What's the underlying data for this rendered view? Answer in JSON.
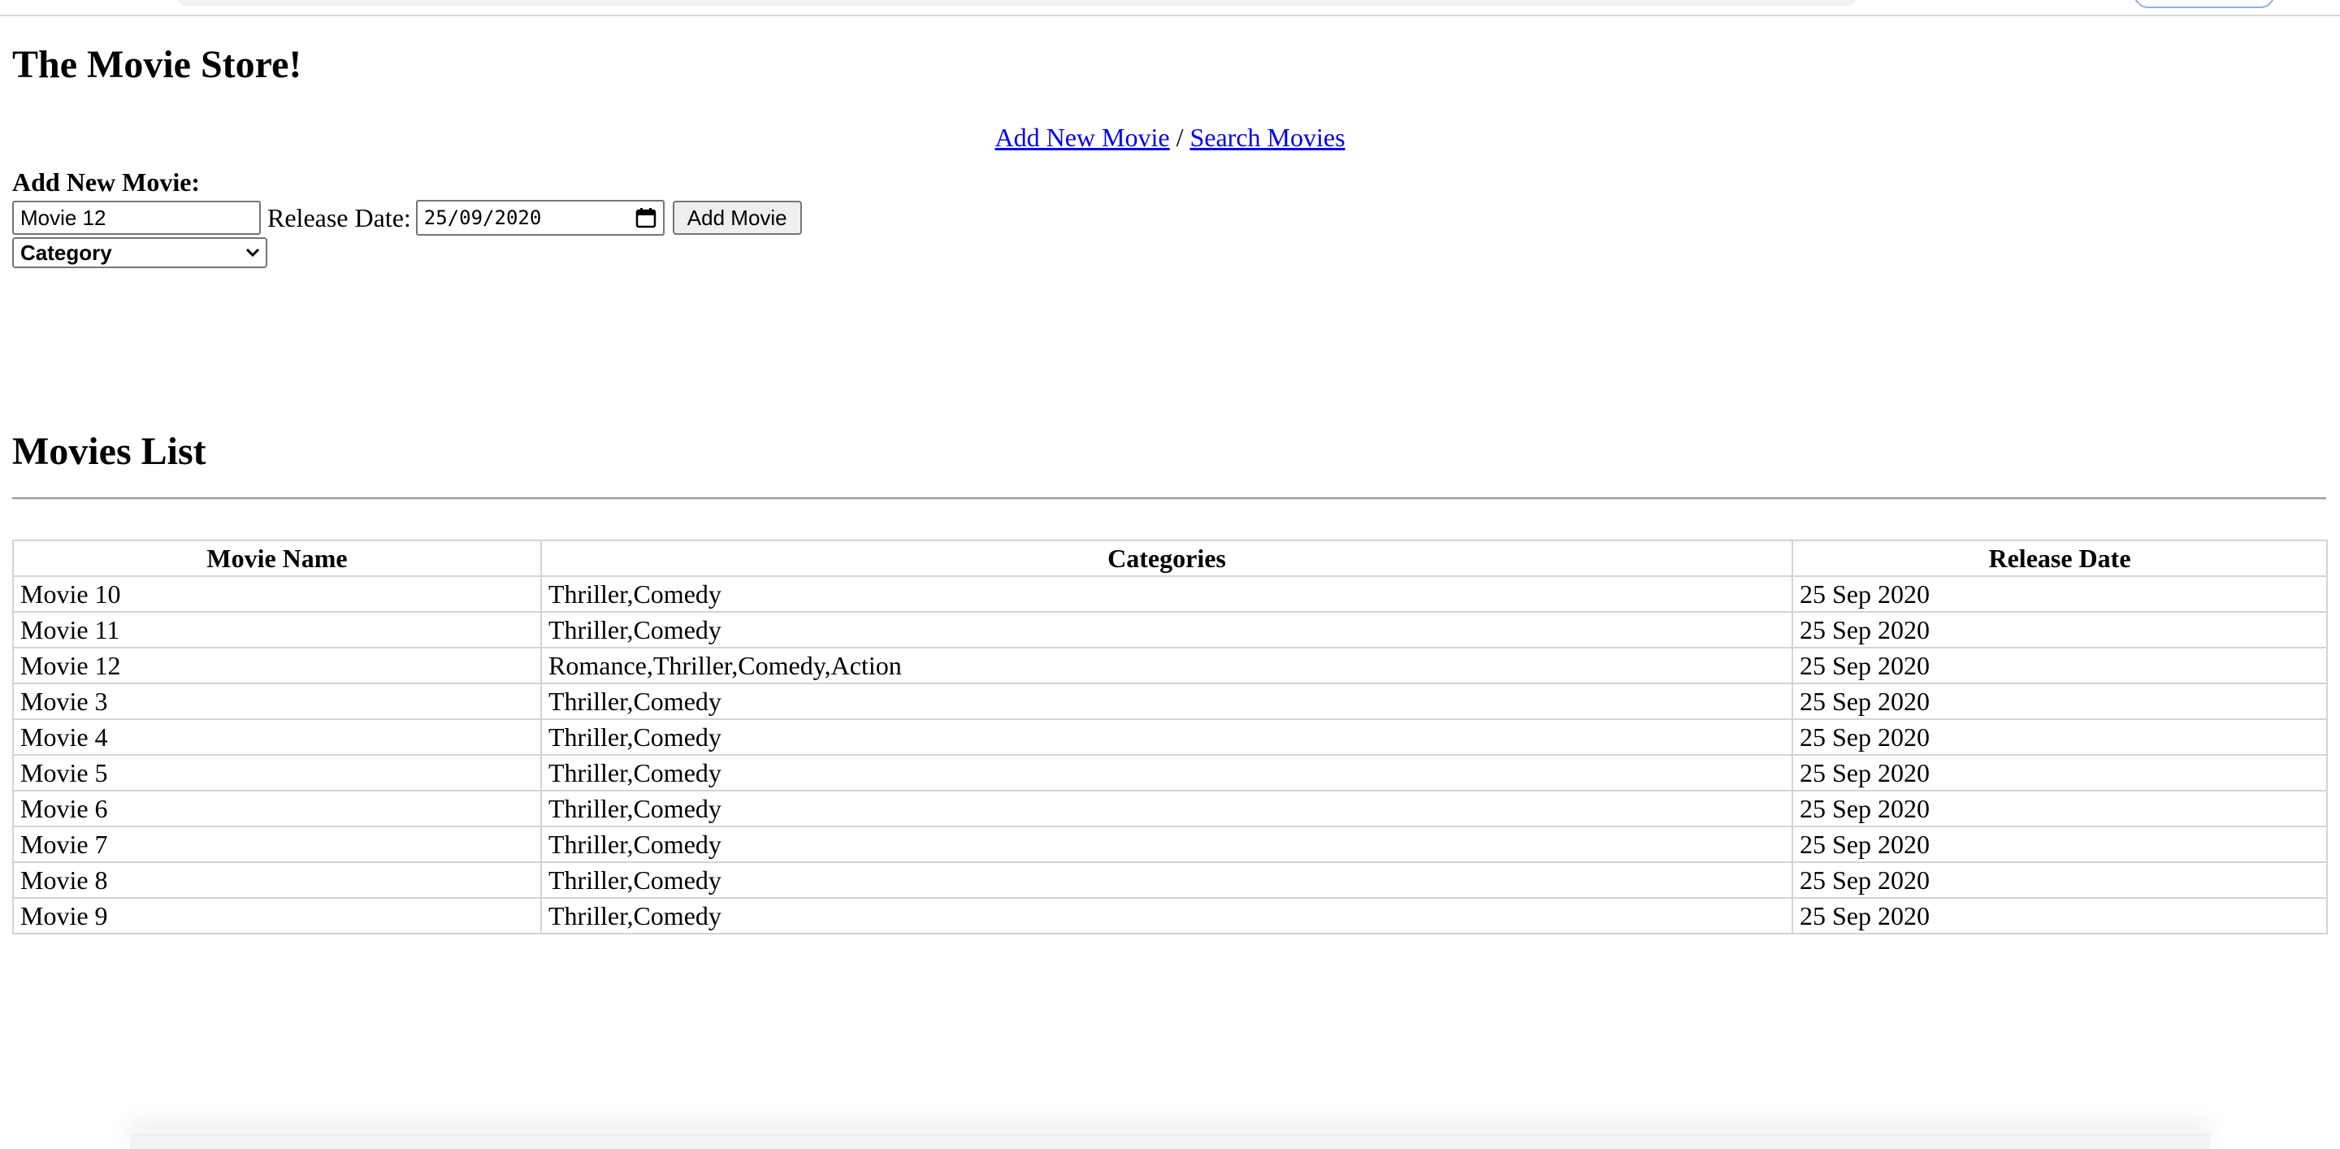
{
  "header": {
    "title": "The Movie Store!"
  },
  "nav": {
    "add_new_movie": "Add New Movie",
    "separator": "/",
    "search_movies": "Search Movies"
  },
  "add_form": {
    "heading": "Add New Movie:",
    "name_value": "Movie 12",
    "release_label": "Release Date:",
    "date_value": "25/09/2020",
    "submit_label": "Add Movie",
    "category_selected": "Category"
  },
  "list": {
    "title": "Movies List",
    "columns": [
      "Movie Name",
      "Categories",
      "Release Date"
    ],
    "rows": [
      [
        "Movie 10",
        "Thriller,Comedy",
        "25 Sep 2020"
      ],
      [
        "Movie 11",
        "Thriller,Comedy",
        "25 Sep 2020"
      ],
      [
        "Movie 12",
        "Romance,Thriller,Comedy,Action",
        "25 Sep 2020"
      ],
      [
        "Movie 3",
        "Thriller,Comedy",
        "25 Sep 2020"
      ],
      [
        "Movie 4",
        "Thriller,Comedy",
        "25 Sep 2020"
      ],
      [
        "Movie 5",
        "Thriller,Comedy",
        "25 Sep 2020"
      ],
      [
        "Movie 6",
        "Thriller,Comedy",
        "25 Sep 2020"
      ],
      [
        "Movie 7",
        "Thriller,Comedy",
        "25 Sep 2020"
      ],
      [
        "Movie 8",
        "Thriller,Comedy",
        "25 Sep 2020"
      ],
      [
        "Movie 9",
        "Thriller,Comedy",
        "25 Sep 2020"
      ]
    ]
  },
  "icons": {
    "date_picker": "calendar-icon",
    "select_arrow": "chevron-down-icon"
  },
  "colors": {
    "link": "#0000ee",
    "border": "#d4d4d4"
  }
}
